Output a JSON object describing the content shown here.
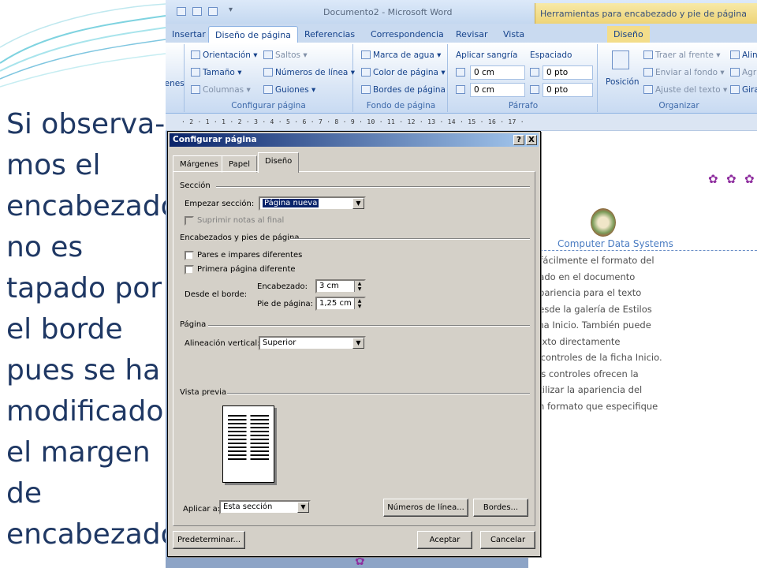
{
  "slide": {
    "text_lines": [
      "Si observa-",
      "mos el",
      "encabezado",
      "no es",
      "tapado por",
      "el borde",
      "pues se ha",
      "modificado",
      "el margen",
      "de",
      "encabezado"
    ]
  },
  "word": {
    "window_title": "Documento2 - Microsoft Word",
    "context_tools_label": "Herramientas para encabezado y pie de página",
    "tabs": [
      "Insertar",
      "Diseño de página",
      "Referencias",
      "Correspondencia",
      "Revisar",
      "Vista",
      "Diseño"
    ],
    "active_tab": "Diseño de página",
    "ribbon": {
      "margenes_fragment": "genes",
      "configurar": {
        "orientacion": "Orientación",
        "tamano": "Tamaño",
        "columnas": "Columnas",
        "saltos": "Saltos",
        "numeros_linea": "Números de línea",
        "guiones": "Guiones",
        "label": "Configurar página"
      },
      "fondo": {
        "marca_agua": "Marca de agua",
        "color_pagina": "Color de página",
        "bordes_pagina": "Bordes de página",
        "label": "Fondo de página"
      },
      "parrafo": {
        "aplicar_sangria": "Aplicar sangría",
        "espaciado": "Espaciado",
        "sangria_izq": "0 cm",
        "sangria_der": "0 cm",
        "esp_antes": "0 pto",
        "esp_despues": "0 pto",
        "label": "Párrafo"
      },
      "organizar": {
        "posicion": "Posición",
        "traer_frente": "Traer al frente",
        "enviar_fondo": "Enviar al fondo",
        "ajuste_texto": "Ajuste del texto",
        "alin": "Alin",
        "agr": "Agr",
        "gir": "Gira",
        "label": "Organizar"
      }
    },
    "ruler_numbers": "· 2 · 1 · 1 · 2 · 3 · 4 · 5 · 6 · 7 · 8 · 9 · 10 · 11 · 12 · 13 · 14 · 15 · 16 · 17 ·",
    "document": {
      "company": "Computer Data Systems",
      "body_lines": [
        "r fácilmente el formato del",
        "nado en el documento",
        "apariencia para el texto",
        "desde la galería de Estilos",
        "cha Inicio. También puede",
        "texto directamente",
        "s controles de la ficha Inicio.",
        "los controles ofrecen la",
        "utilizar la apariencia del",
        "an formato que especifique"
      ]
    }
  },
  "dialog": {
    "title": "Configurar página",
    "help_btn": "?",
    "close_btn": "X",
    "tabs": [
      "Márgenes",
      "Papel",
      "Diseño"
    ],
    "active_tab": "Diseño",
    "seccion": {
      "heading": "Sección",
      "empezar_label": "Empezar sección:",
      "empezar_value": "Página nueva",
      "suprimir_label": "Suprimir notas al final"
    },
    "encabezados": {
      "heading": "Encabezados y pies de página",
      "pares_label": "Pares e impares diferentes",
      "primera_label": "Primera página diferente",
      "desde_borde": "Desde el borde:",
      "encabezado_label": "Encabezado:",
      "encabezado_value": "3 cm",
      "pie_label": "Pie de página:",
      "pie_value": "1,25 cm"
    },
    "pagina": {
      "heading": "Página",
      "alineacion_label": "Alineación vertical:",
      "alineacion_value": "Superior"
    },
    "vista_previa": "Vista previa",
    "aplicar_label": "Aplicar a:",
    "aplicar_value": "Esta sección",
    "numeros_linea_btn": "Números de línea...",
    "bordes_btn": "Bordes...",
    "predeterminar_btn": "Predeterminar...",
    "aceptar_btn": "Aceptar",
    "cancelar_btn": "Cancelar"
  }
}
